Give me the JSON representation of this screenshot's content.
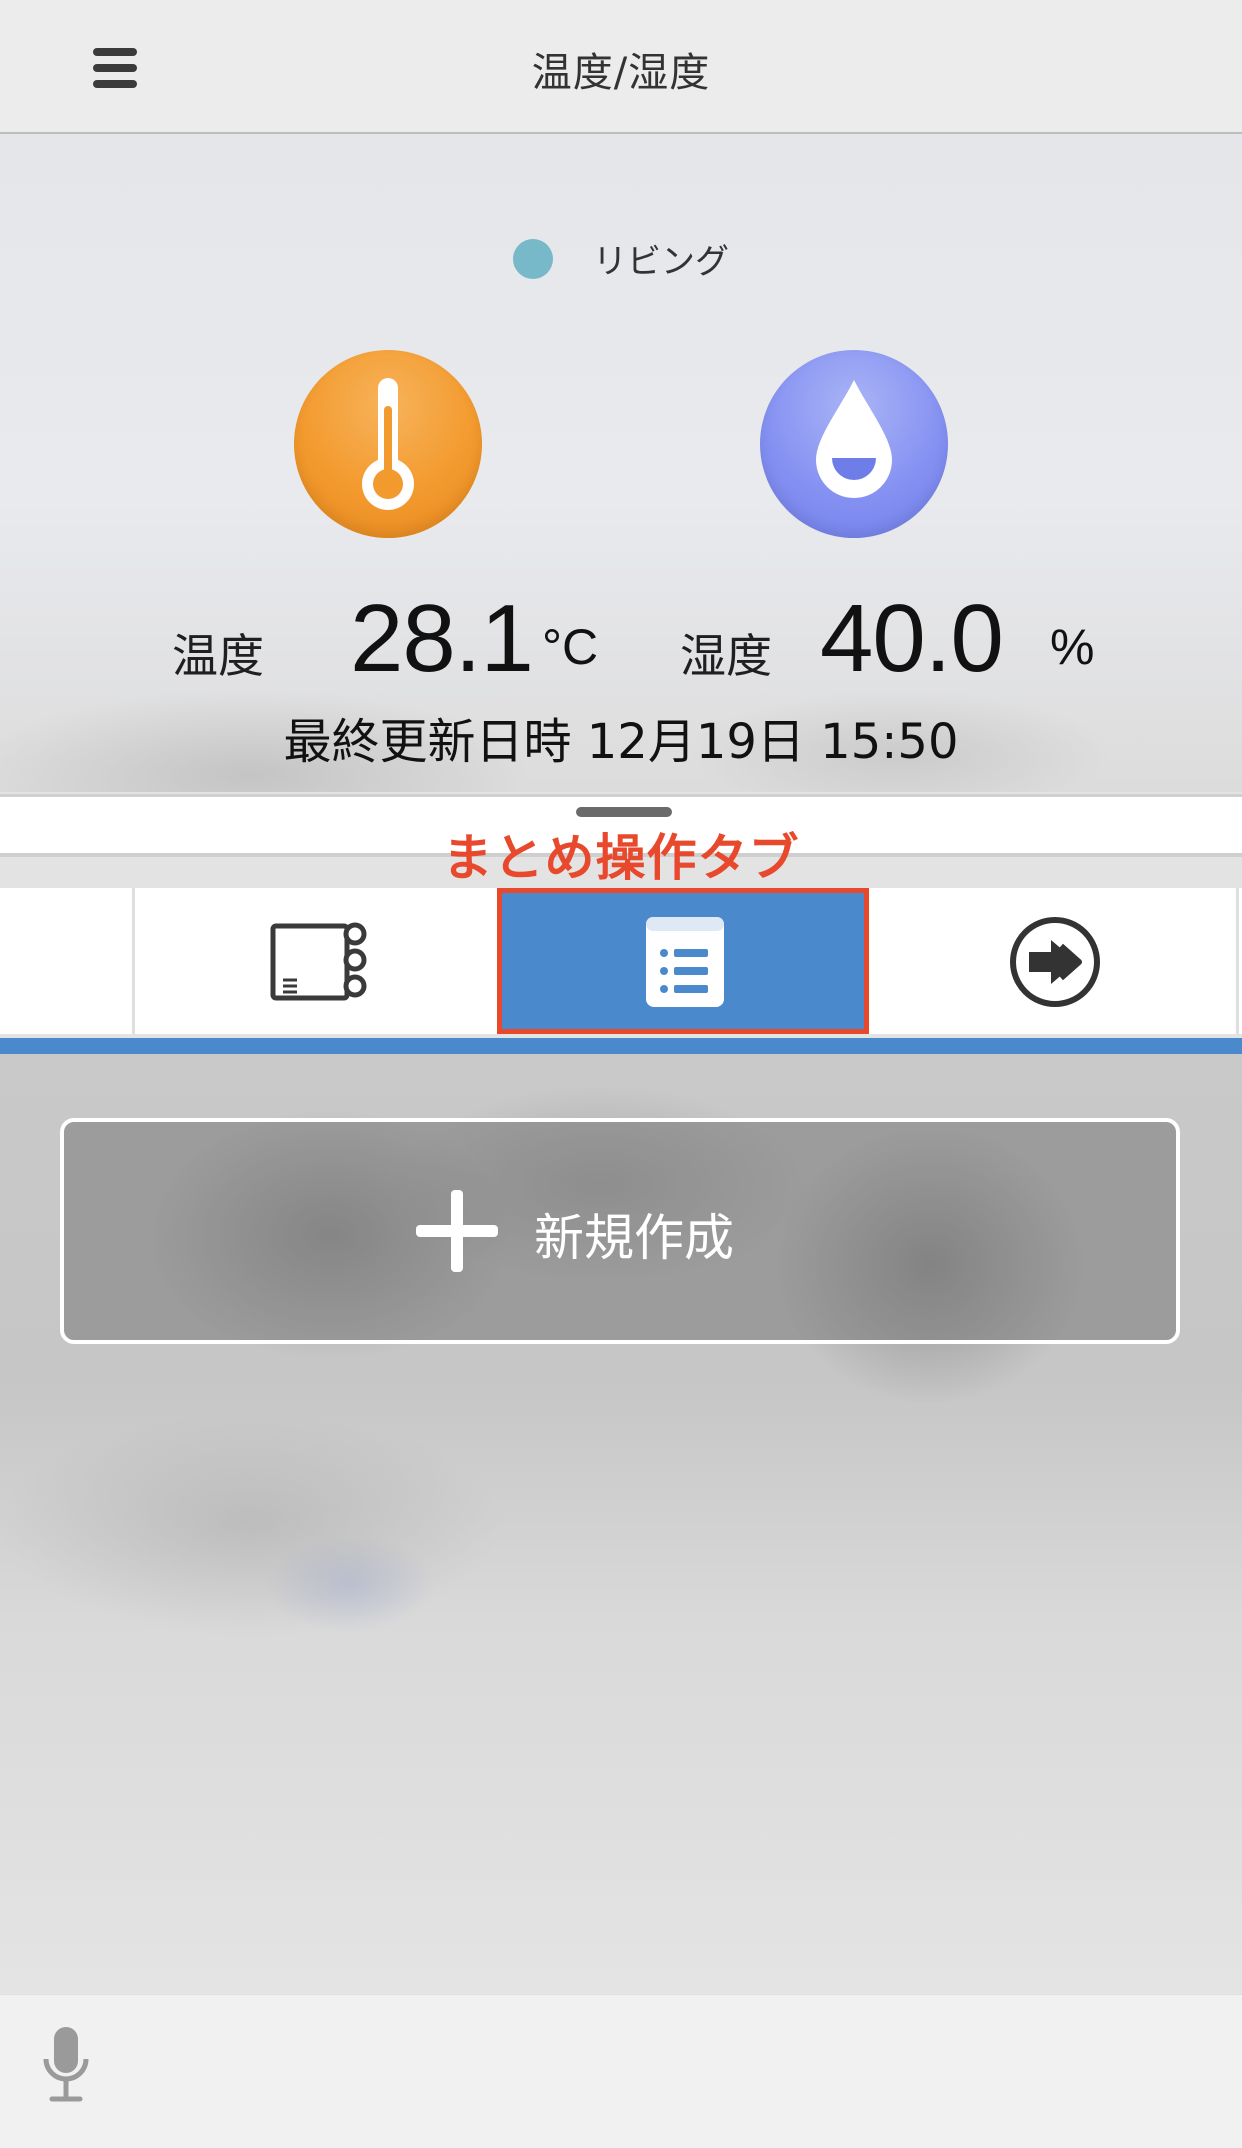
{
  "header": {
    "title": "温度/湿度",
    "menu_icon": "hamburger-menu-icon"
  },
  "sensor": {
    "room_name": "リビング",
    "room_color": "#78b9c9",
    "temperature": {
      "label": "温度",
      "value": "28.1",
      "unit": "°C",
      "icon": "thermometer-icon",
      "color": "#f39a2e"
    },
    "humidity": {
      "label": "湿度",
      "value": "40.0",
      "unit": "%",
      "icon": "water-drop-icon",
      "color": "#8692f2"
    },
    "last_updated_label": "最終更新日時",
    "last_updated_value": "12月19日 15:50"
  },
  "annotation": {
    "text": "まとめ操作タブ",
    "color": "#e8492c"
  },
  "tabs": [
    {
      "name": "device-panel",
      "icon": "device-panel-icon",
      "active": false
    },
    {
      "name": "group-operation",
      "icon": "list-document-icon",
      "active": true
    },
    {
      "name": "scene",
      "icon": "arrow-circle-icon",
      "active": false
    }
  ],
  "tab_accent_color": "#4a89cc",
  "content": {
    "new_button_label": "新規作成",
    "new_button_icon": "plus-icon"
  },
  "bottom_bar": {
    "mic_icon": "microphone-icon"
  }
}
